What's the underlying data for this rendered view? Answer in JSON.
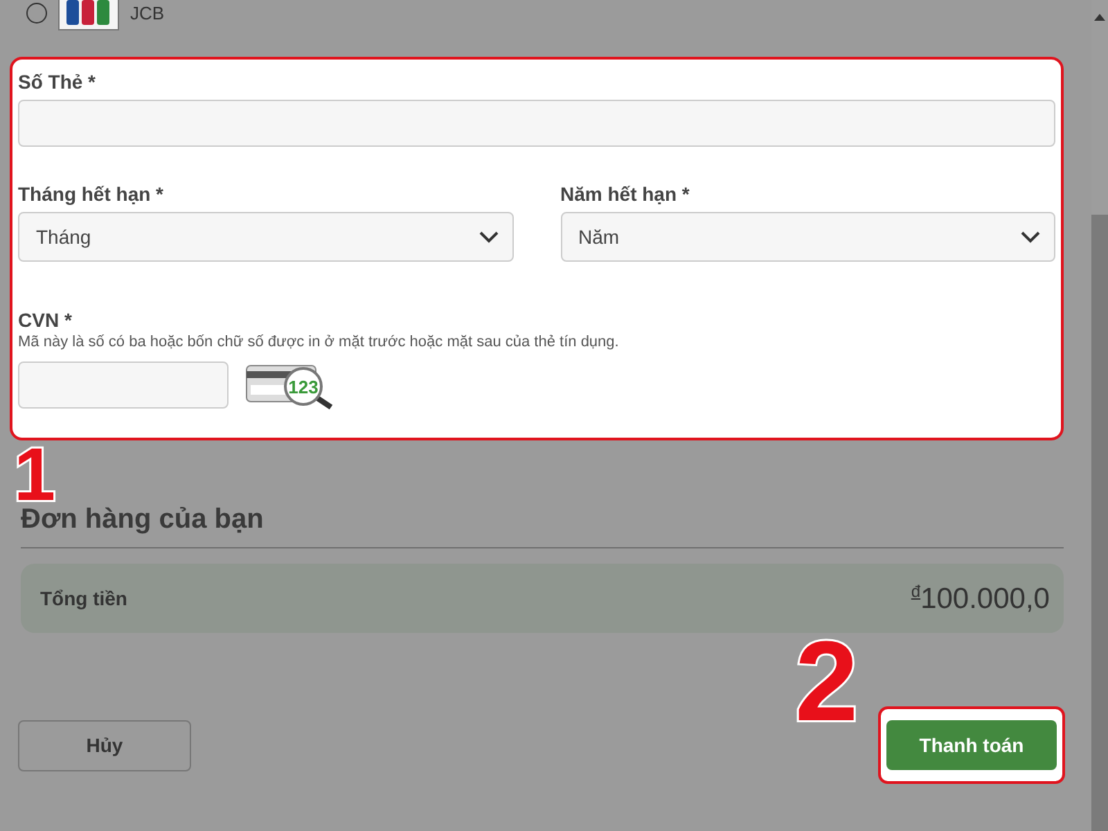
{
  "payment_option": {
    "label": "JCB",
    "selected": false
  },
  "card_form": {
    "card_number": {
      "label": "Số Thẻ *"
    },
    "expiry_month": {
      "label": "Tháng hết hạn *",
      "value": "Tháng"
    },
    "expiry_year": {
      "label": "Năm hết hạn *",
      "value": "Năm"
    },
    "cvn": {
      "label": "CVN *",
      "hint": "Mã này là số có ba hoặc bốn chữ số được in ở mặt trước hoặc mặt sau của thẻ tín dụng.",
      "example": "123"
    }
  },
  "order": {
    "title": "Đơn hàng của bạn",
    "total_label": "Tổng tiền",
    "currency": "đ",
    "total": "100.000,0"
  },
  "buttons": {
    "cancel": "Hủy",
    "pay": "Thanh toán"
  },
  "annotations": [
    {
      "number": "1"
    },
    {
      "number": "2"
    }
  ]
}
